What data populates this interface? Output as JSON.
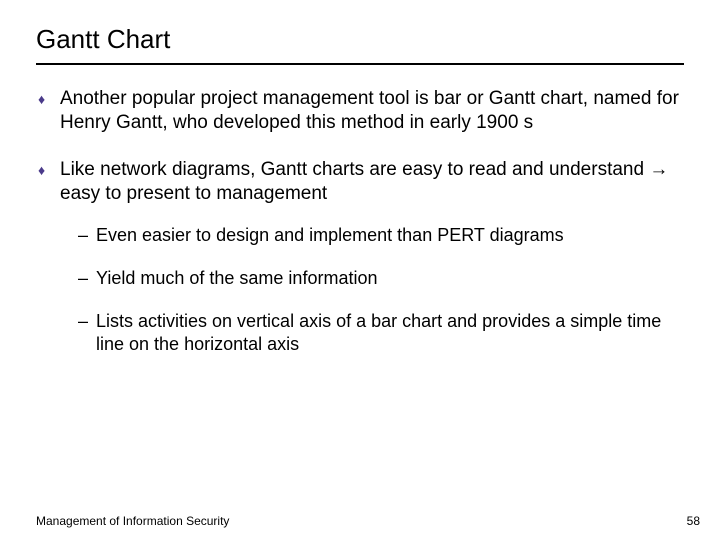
{
  "title": "Gantt Chart",
  "bullets": [
    {
      "text": "Another popular project management tool is bar or Gantt chart, named for Henry Gantt, who developed this method in early 1900 s"
    },
    {
      "text": "Like network diagrams, Gantt charts are easy to read and understand → easy to present to management",
      "sub": [
        "Even easier to design and implement than PERT diagrams",
        "Yield much of the same information",
        "Lists activities on vertical axis of a bar chart and provides a simple time line on the horizontal axis"
      ]
    }
  ],
  "footer": {
    "left": "Management of Information Security",
    "right": "58"
  }
}
